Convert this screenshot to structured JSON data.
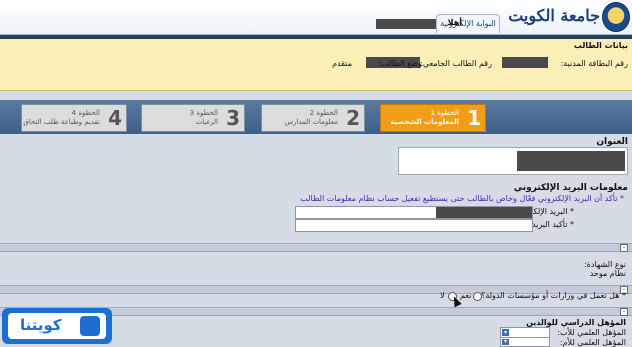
{
  "header": {
    "university_name": "جامعة الكويت",
    "portal_tab": "البوابة الإلكترونية",
    "welcome": "أهلا"
  },
  "student_panel": {
    "title": "بيانات الطالب",
    "civil_id_label": "رقم البطاقة المدنية:",
    "student_id_label": "رقم الطالب الجامعي:",
    "status_label": "وضع الطالب:",
    "status_value": "متقدم"
  },
  "steps": [
    {
      "title": "الخطوة 1",
      "subtitle": "المعلومات الشخصية",
      "number": "1"
    },
    {
      "title": "الخطوة 2",
      "subtitle": "معلومات المدارس",
      "number": "2"
    },
    {
      "title": "الخطوة 3",
      "subtitle": "الرغبات",
      "number": "3"
    },
    {
      "title": "الخطوة 4",
      "subtitle": "تقديم وطباعة طلب التحاق",
      "number": "4"
    }
  ],
  "address": {
    "title": "العنوان"
  },
  "email": {
    "title": "معلومات البريد الإلكتروني",
    "note": "* تأكد أن البريد الإلكتروني فعّال وخاص بالطالب حتى يستطيع تفعيل حساب نظام معلومات الطالب",
    "email_label": "* البريد الإلكتروني:",
    "confirm_label": "* تأكيد البريد الإلكتروني:"
  },
  "certificate": {
    "type_label": "نوع الشهادة:",
    "type_value": "نظام موحد"
  },
  "employment": {
    "question": "* هل تعمل في وزارات أو مؤسسات الدولة؟",
    "yes": "نعم",
    "no": "لا"
  },
  "parents": {
    "title": "المؤهل الدراسي للوالدين",
    "father_label": "المؤهل العلمي للأب:",
    "mother_label": "المؤهل العلمي للأم:"
  },
  "watermark": {
    "text": "كويتنا"
  },
  "colors": {
    "step_active": "#f29d17",
    "info_panel": "#fbeeb6",
    "note_text": "#3d2bb2"
  }
}
